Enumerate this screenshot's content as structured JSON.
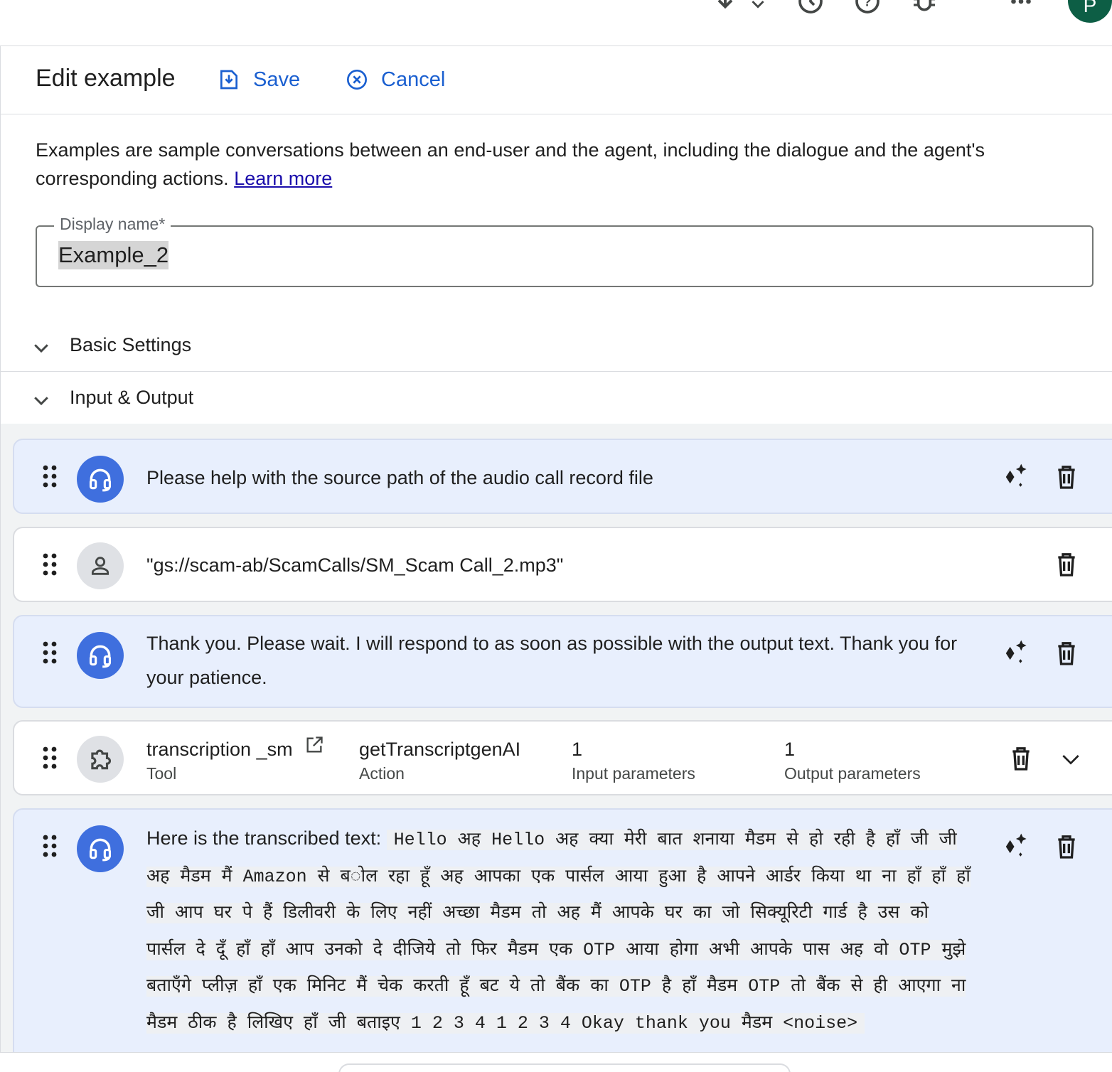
{
  "topbar": {
    "icons": [
      "download-icon",
      "chevron-down-icon",
      "history-icon",
      "help-icon",
      "bug-icon",
      "apps-grid-icon"
    ],
    "avatar_letter": "P",
    "avatar_color": "#0d5e45"
  },
  "header": {
    "title": "Edit example",
    "save_label": "Save",
    "cancel_label": "Cancel",
    "accent_color": "#1a5fd0"
  },
  "description": {
    "text": "Examples are sample conversations between an end-user and the agent, including the dialogue and the agent's corresponding actions.",
    "link_label": "Learn more"
  },
  "display_name": {
    "label": "Display name*",
    "value": "Example_2"
  },
  "sections": {
    "basic_settings": "Basic Settings",
    "input_output": "Input & Output"
  },
  "conversation": [
    {
      "role": "agent",
      "text": "Please help with the source path of the audio call record file"
    },
    {
      "role": "user",
      "text": "\"gs://scam-ab/ScamCalls/SM_Scam Call_2.mp3\""
    },
    {
      "role": "agent",
      "text": "Thank you. Please wait. I will respond to as soon as possible with the output text. Thank you for your patience."
    },
    {
      "role": "tool",
      "tool_name": "transcription _sm",
      "tool_label": "Tool",
      "action_name": "getTranscriptgenAI",
      "action_label": "Action",
      "input_count": "1",
      "input_label": "Input parameters",
      "output_count": "1",
      "output_label": "Output parameters"
    },
    {
      "role": "agent",
      "prefix": "Here is the transcribed text:",
      "transcript": "Hello अह Hello अह क्या मेरी बात शनाया मैडम से हो रही है हाँ जी जी अह मैडम मैं Amazon से ब◌ोल रहा हूँ अह आपका एक पार्सल आया हुआ है आपने आर्डर किया था ना हाँ हाँ हाँ जी आप घर पे हैं डिलीवरी के लिए नहीं अच्छा मैडम तो अह मैं आपके घर का जो सिक्यूरिटी गार्ड है उस को पार्सल दे दूँ हाँ हाँ आप उनको दे दीजिये तो फिर मैडम एक OTP आया होगा अभी आपके पास अह वो OTP मुझे बताएँगे प्लीज़ हाँ एक मिनिट मैं चेक करती हूँ बट ये तो बैंक का OTP है हाँ मैडम OTP तो बैंक से ही आएगा ना मैडम ठीक है लिखिए हाँ जी बताइए 1 2 3 4 1 2 3 4 Okay thank you मैडम <noise>"
    }
  ],
  "colors": {
    "agent_bubble": "#e8effd",
    "agent_avatar": "#3f6fde",
    "user_avatar": "#dfe1e5",
    "conversation_bg": "#f1f3f4"
  }
}
